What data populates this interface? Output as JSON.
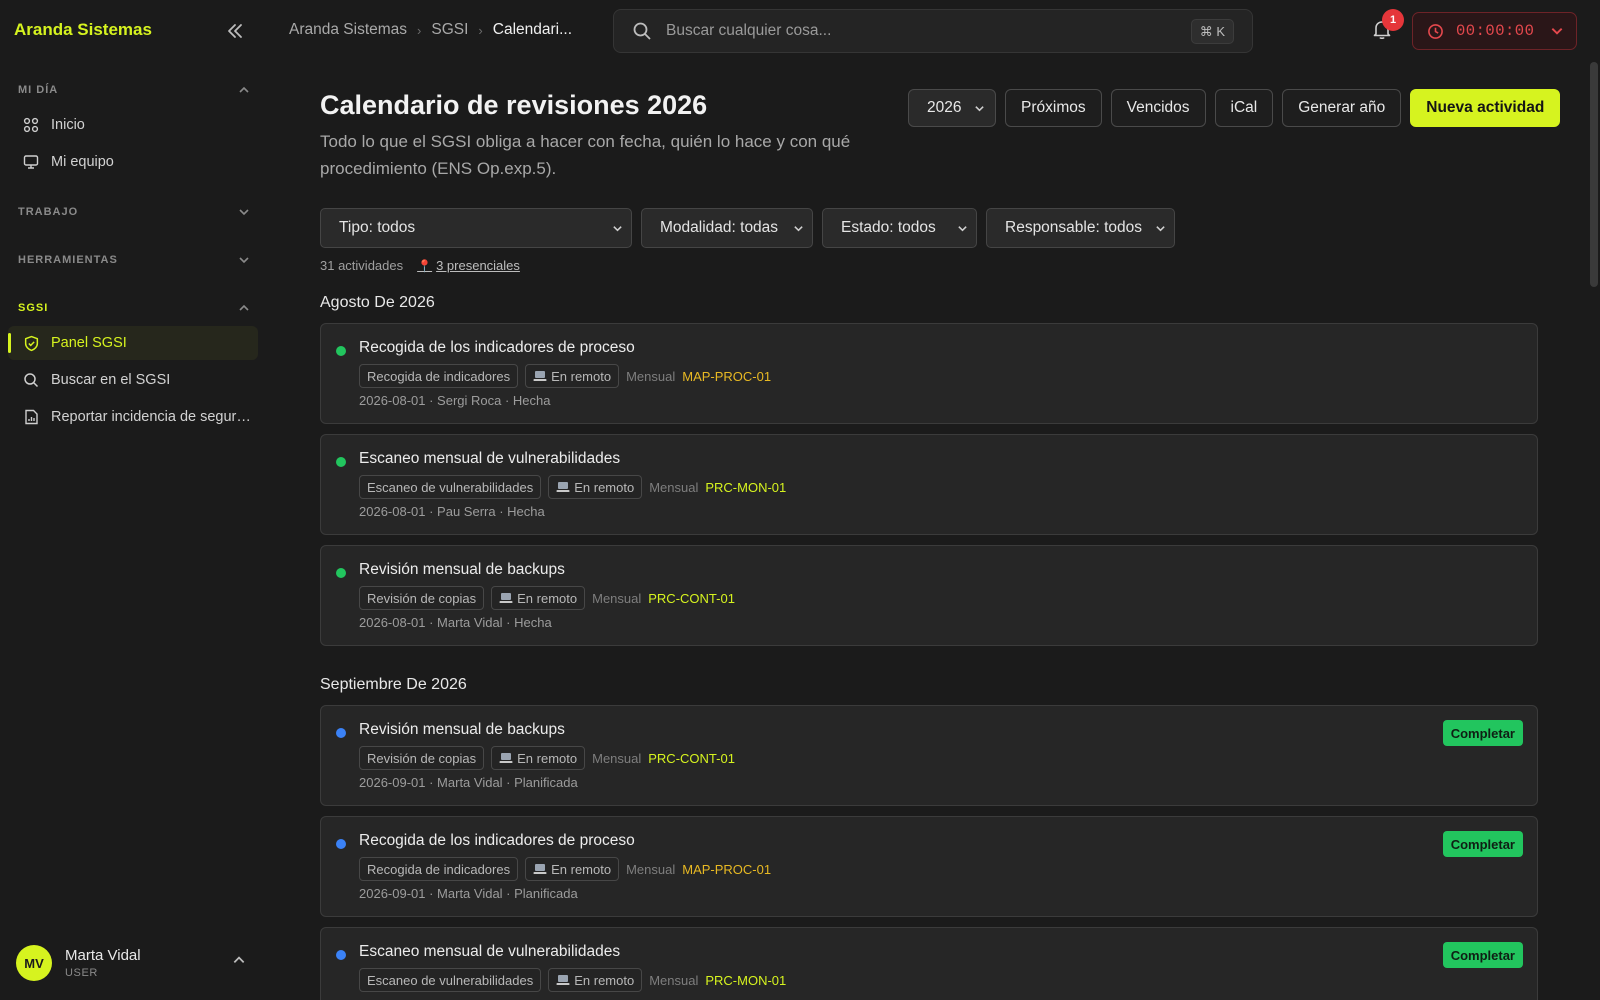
{
  "sidebar": {
    "brand": "Aranda Sistemas",
    "sections": {
      "mi_dia": "MI DÍA",
      "trabajo": "TRABAJO",
      "herramientas": "HERRAMIENTAS",
      "sgsi": "SGSI"
    },
    "items": [
      {
        "label": "Inicio",
        "icon": "grid-icon"
      },
      {
        "label": "Mi equipo",
        "icon": "monitor-icon"
      },
      {
        "label": "Panel SGSI",
        "icon": "shield-check-icon",
        "active": true
      },
      {
        "label": "Buscar en el SGSI",
        "icon": "search-icon"
      },
      {
        "label": "Reportar incidencia de seguri...",
        "icon": "report-icon"
      }
    ],
    "user": {
      "initials": "MV",
      "name": "Marta Vidal",
      "role": "USER"
    }
  },
  "topbar": {
    "breadcrumb": [
      "Aranda Sistemas",
      "SGSI",
      "Calendari..."
    ],
    "search_placeholder": "Buscar cualquier cosa...",
    "search_shortcut": "⌘ K",
    "notification_count": "1",
    "timer": "00:00:00"
  },
  "header": {
    "title": "Calendario de revisiones 2026",
    "description": "Todo lo que el SGSI obliga a hacer con fecha, quién lo hace y con qué procedimiento (ENS Op.exp.5).",
    "year_select": "2026",
    "buttons": {
      "upcoming": "Próximos",
      "overdue": "Vencidos",
      "ical": "iCal",
      "generate": "Generar año",
      "new": "Nueva actividad"
    }
  },
  "filters": {
    "type": "Tipo: todos",
    "mode": "Modalidad: todas",
    "state": "Estado: todos",
    "owner": "Responsable: todos"
  },
  "summary": {
    "count": "31 actividades",
    "onsite": "3 presenciales"
  },
  "months": [
    {
      "label": "Agosto De 2026",
      "activities": [
        {
          "title": "Recogida de los indicadores de proceso",
          "type": "Recogida de indicadores",
          "mode": "En remoto",
          "freq": "Mensual",
          "proc": "MAP-PROC-01",
          "meta": "2026-08-01 · Sergi Roca · Hecha",
          "status": "done"
        },
        {
          "title": "Escaneo mensual de vulnerabilidades",
          "type": "Escaneo de vulnerabilidades",
          "mode": "En remoto",
          "freq": "Mensual",
          "proc": "PRC-MON-01",
          "meta": "2026-08-01 · Pau Serra · Hecha",
          "status": "done"
        },
        {
          "title": "Revisión mensual de backups",
          "type": "Revisión de copias",
          "mode": "En remoto",
          "freq": "Mensual",
          "proc": "PRC-CONT-01",
          "meta": "2026-08-01 · Marta Vidal · Hecha",
          "status": "done"
        }
      ]
    },
    {
      "label": "Septiembre De 2026",
      "activities": [
        {
          "title": "Revisión mensual de backups",
          "type": "Revisión de copias",
          "mode": "En remoto",
          "freq": "Mensual",
          "proc": "PRC-CONT-01",
          "meta": "2026-09-01 · Marta Vidal · Planificada",
          "status": "planned",
          "action": "Completar"
        },
        {
          "title": "Recogida de los indicadores de proceso",
          "type": "Recogida de indicadores",
          "mode": "En remoto",
          "freq": "Mensual",
          "proc": "MAP-PROC-01",
          "meta": "2026-09-01 · Marta Vidal · Planificada",
          "status": "planned",
          "action": "Completar"
        },
        {
          "title": "Escaneo mensual de vulnerabilidades",
          "type": "Escaneo de vulnerabilidades",
          "mode": "En remoto",
          "freq": "Mensual",
          "proc": "PRC-MON-01",
          "meta": "",
          "status": "planned",
          "action": "Completar"
        }
      ]
    }
  ],
  "colors": {
    "accent": "#d6f31f",
    "done": "#22c55e",
    "planned": "#3b82f6",
    "danger": "#e5484d",
    "amber_code": "#e8b923"
  }
}
